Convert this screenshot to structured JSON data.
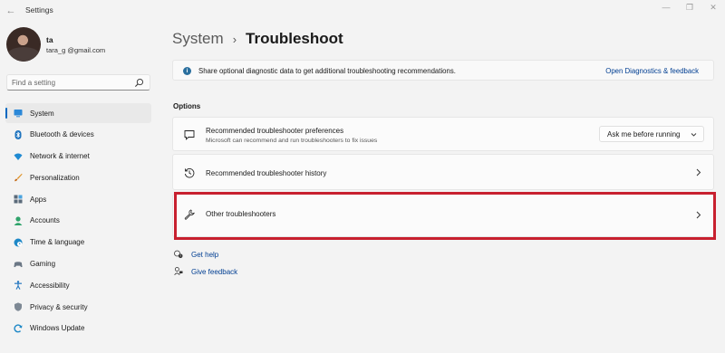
{
  "window": {
    "title": "Settings",
    "back_glyph": "←",
    "controls": [
      "—",
      "❐",
      "✕"
    ]
  },
  "profile": {
    "name": "ta",
    "email": "tara_g            @gmail.com"
  },
  "search": {
    "placeholder": "Find a setting",
    "icon": "search-icon"
  },
  "sidebar": {
    "items": [
      {
        "label": "System",
        "icon": "monitor-icon",
        "active": true
      },
      {
        "label": "Bluetooth & devices",
        "icon": "bluetooth-icon"
      },
      {
        "label": "Network & internet",
        "icon": "wifi-icon"
      },
      {
        "label": "Personalization",
        "icon": "brush-icon"
      },
      {
        "label": "Apps",
        "icon": "apps-icon"
      },
      {
        "label": "Accounts",
        "icon": "person-icon"
      },
      {
        "label": "Time & language",
        "icon": "globe-clock-icon"
      },
      {
        "label": "Gaming",
        "icon": "gamepad-icon"
      },
      {
        "label": "Accessibility",
        "icon": "accessibility-icon"
      },
      {
        "label": "Privacy & security",
        "icon": "shield-icon"
      },
      {
        "label": "Windows Update",
        "icon": "update-icon"
      }
    ]
  },
  "header": {
    "parent": "System",
    "separator": "›",
    "current": "Troubleshoot"
  },
  "info": {
    "icon_glyph": "i",
    "text": "Share optional diagnostic data to get additional troubleshooting recommendations.",
    "link": "Open Diagnostics & feedback"
  },
  "options": {
    "heading": "Options",
    "cards": [
      {
        "title": "Recommended troubleshooter preferences",
        "subtitle": "Microsoft can recommend and run troubleshooters to fix issues",
        "icon": "chat-bubble-icon",
        "dropdown_value": "Ask me before running"
      },
      {
        "title": "Recommended troubleshooter history",
        "icon": "history-icon"
      },
      {
        "title": "Other troubleshooters",
        "icon": "wrench-icon",
        "highlighted": true
      }
    ]
  },
  "help": {
    "get_help": "Get help",
    "give_feedback": "Give feedback"
  },
  "colors": {
    "accent": "#0067c0",
    "highlight": "#c8202f",
    "link": "#003e92",
    "background": "#f3f3f3"
  }
}
